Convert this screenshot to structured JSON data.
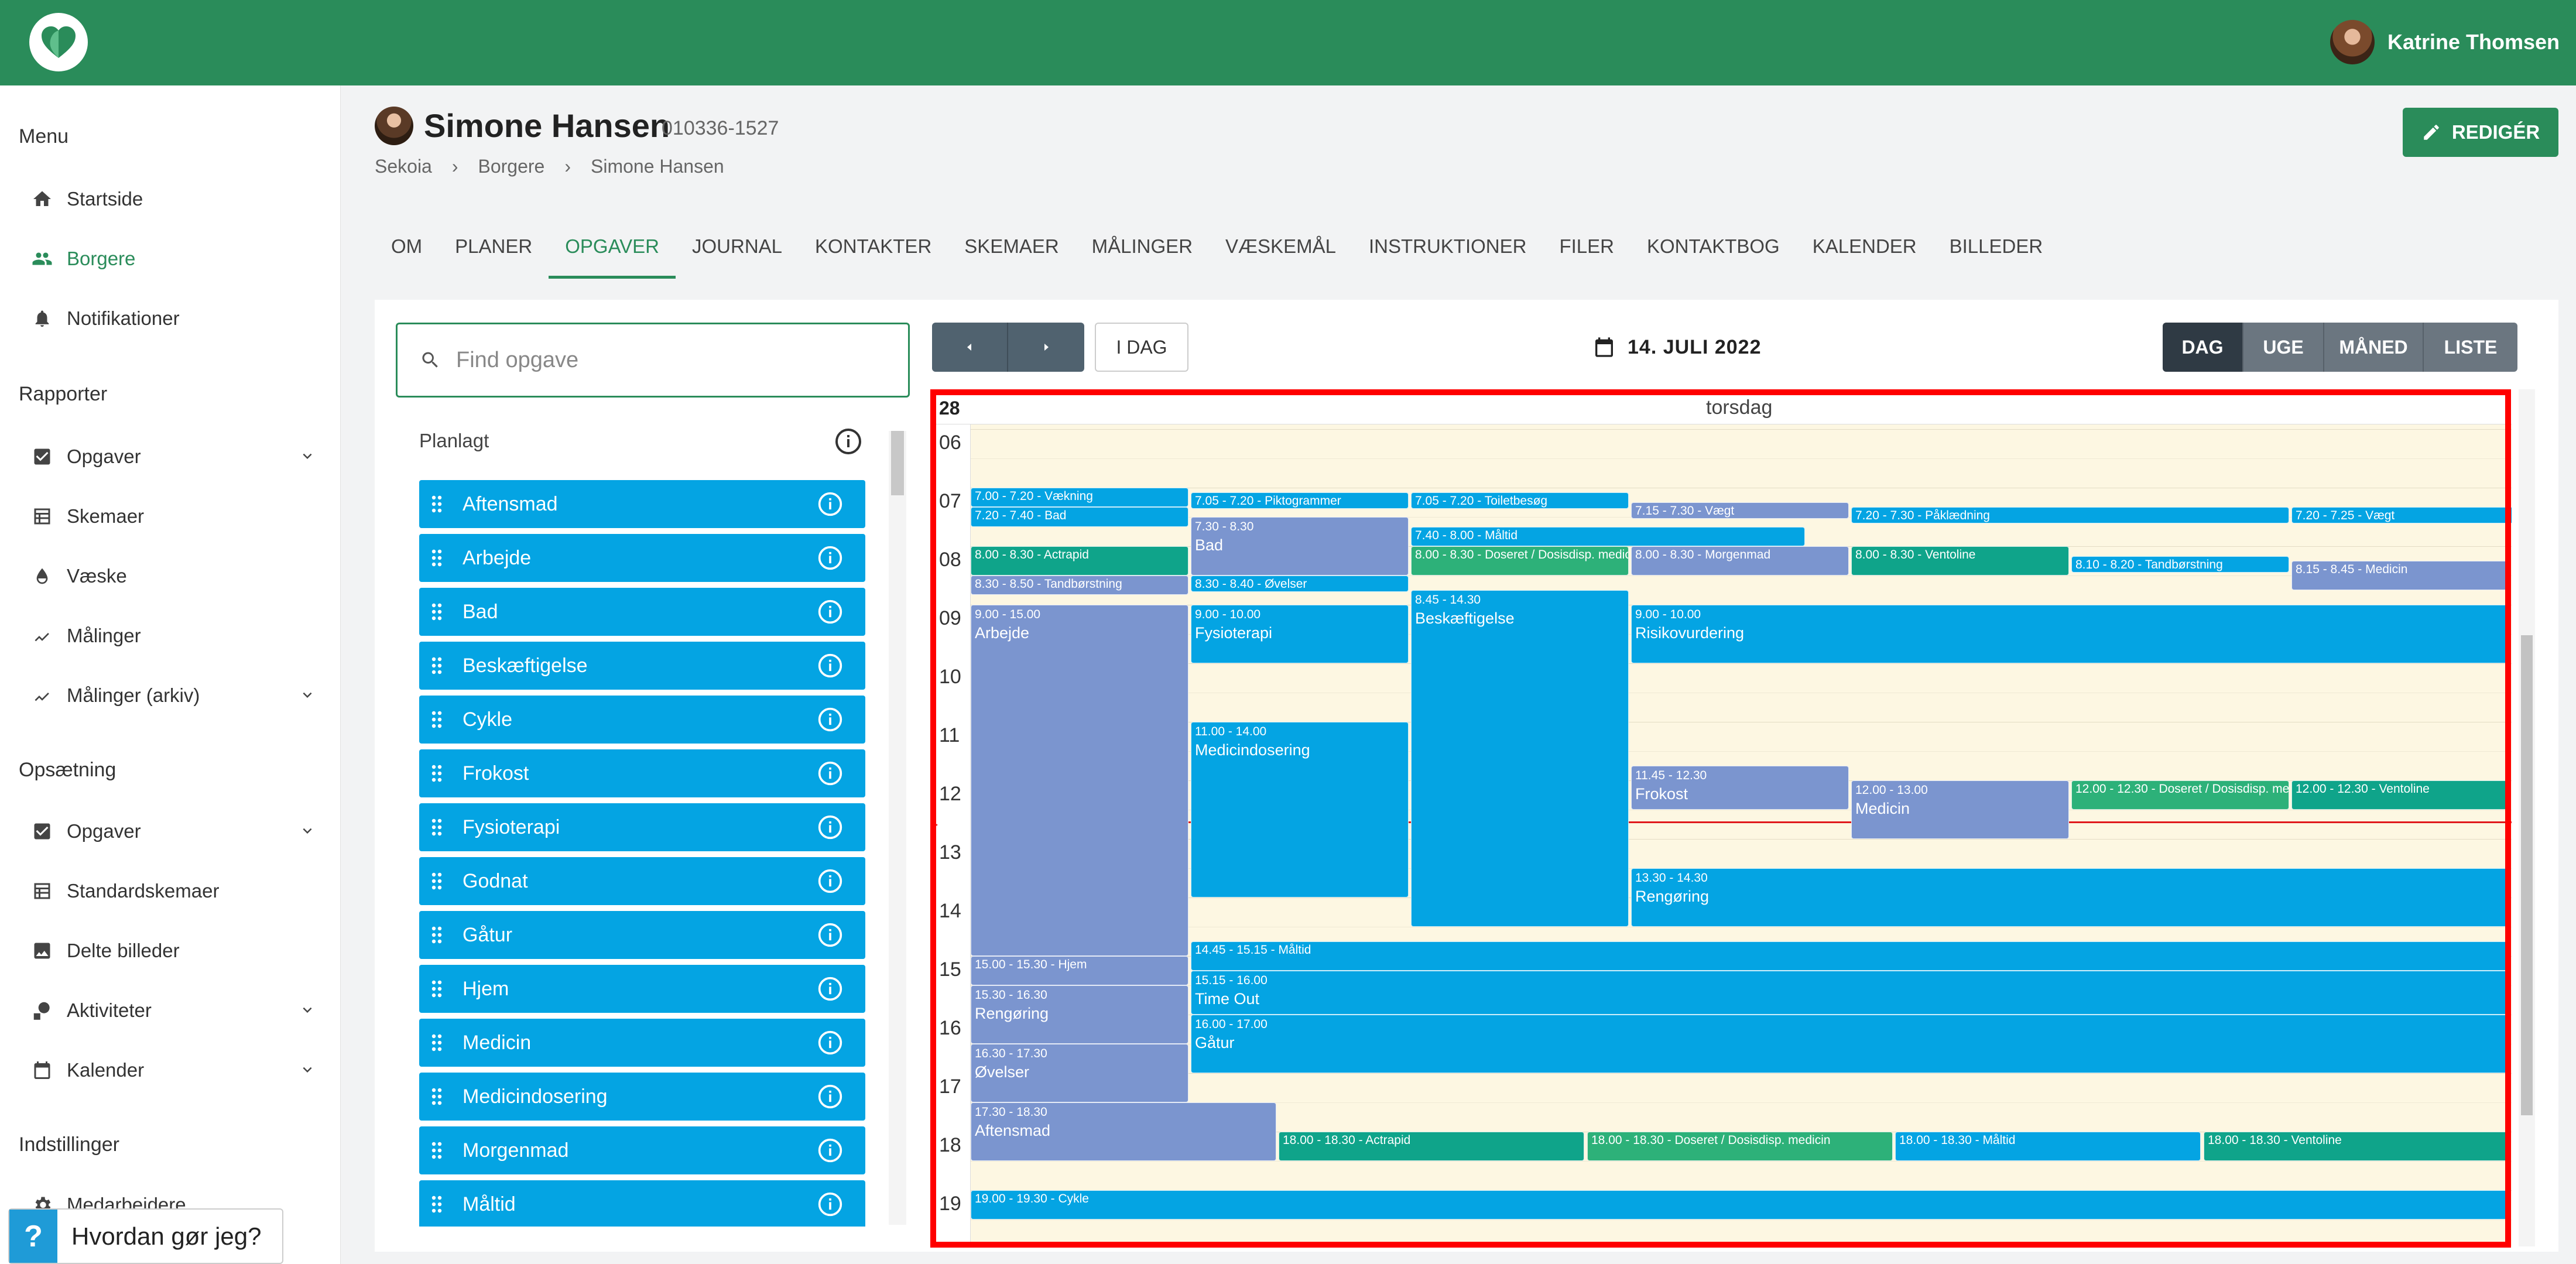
{
  "user": {
    "name": "Katrine Thomsen"
  },
  "sidebar": {
    "sections": [
      {
        "title": "Menu",
        "items": [
          {
            "label": "Startside",
            "icon": "home-icon"
          },
          {
            "label": "Borgere",
            "icon": "people-icon",
            "active": true
          },
          {
            "label": "Notifikationer",
            "icon": "bell-icon"
          }
        ]
      },
      {
        "title": "Rapporter",
        "items": [
          {
            "label": "Opgaver",
            "icon": "checkbox-icon",
            "expandable": true
          },
          {
            "label": "Skemaer",
            "icon": "table-icon"
          },
          {
            "label": "Væske",
            "icon": "drop-icon"
          },
          {
            "label": "Målinger",
            "icon": "trend-icon"
          },
          {
            "label": "Målinger (arkiv)",
            "icon": "trend-icon",
            "expandable": true
          }
        ]
      },
      {
        "title": "Opsætning",
        "items": [
          {
            "label": "Opgaver",
            "icon": "checkbox-icon",
            "expandable": true
          },
          {
            "label": "Standardskemaer",
            "icon": "table-icon"
          },
          {
            "label": "Delte billeder",
            "icon": "image-icon"
          },
          {
            "label": "Aktiviteter",
            "icon": "activity-icon",
            "expandable": true
          },
          {
            "label": "Kalender",
            "icon": "calendar-icon",
            "expandable": true
          }
        ]
      },
      {
        "title": "Indstillinger",
        "items": [
          {
            "label": "Medarbejdere",
            "icon": "gear-icon"
          }
        ]
      }
    ],
    "help": {
      "q": "?",
      "label": "Hvordan gør jeg?"
    }
  },
  "patient": {
    "name": "Simone Hansen",
    "id": "010336-1527"
  },
  "breadcrumb": [
    "Sekoia",
    "Borgere",
    "Simone Hansen"
  ],
  "edit_label": "REDIGÉR",
  "tabs": [
    "OM",
    "PLANER",
    "OPGAVER",
    "JOURNAL",
    "KONTAKTER",
    "SKEMAER",
    "MÅLINGER",
    "VÆSKEMÅL",
    "INSTRUKTIONER",
    "FILER",
    "KONTAKTBOG",
    "KALENDER",
    "BILLEDER"
  ],
  "active_tab": "OPGAVER",
  "search": {
    "placeholder": "Find opgave"
  },
  "planned": {
    "title": "Planlagt",
    "tasks": [
      "Aftensmad",
      "Arbejde",
      "Bad",
      "Beskæftigelse",
      "Cykle",
      "Frokost",
      "Fysioterapi",
      "Godnat",
      "Gåtur",
      "Hjem",
      "Medicin",
      "Medicindosering",
      "Morgenmad",
      "Måltid"
    ]
  },
  "toolbar": {
    "today": "I DAG",
    "date": "14. JULI 2022",
    "views": [
      "DAG",
      "UGE",
      "MÅNED",
      "LISTE"
    ],
    "active_view": "DAG"
  },
  "calendar": {
    "week": "28",
    "day": "torsdag",
    "hours": [
      "06",
      "07",
      "08",
      "09",
      "10",
      "11",
      "12",
      "13",
      "14",
      "15",
      "16",
      "17",
      "18",
      "19"
    ],
    "colors": {
      "blue": "#04a4e3",
      "lavender": "#7b95cf",
      "teal": "#0fa48a",
      "green": "#2db179"
    },
    "events": [
      {
        "time": "7.00 - 7.20",
        "label": "Vækning",
        "color": "blue"
      },
      {
        "time": "7.05 - 7.20",
        "label": "Piktogrammer",
        "color": "blue"
      },
      {
        "time": "7.05 - 7.20",
        "label": "Toiletbesøg",
        "color": "blue"
      },
      {
        "time": "7.15 - 7.30",
        "label": "Vægt",
        "color": "lavender"
      },
      {
        "time": "7.20 - 7.30",
        "label": "Påklædning",
        "color": "blue"
      },
      {
        "time": "7.20 - 7.25",
        "label": "Vægt",
        "color": "blue"
      },
      {
        "time": "7.20 - 7.40",
        "label": "Bad",
        "color": "blue"
      },
      {
        "time": "7.30 - 8.30",
        "label": "Bad",
        "color": "lavender"
      },
      {
        "time": "7.40 - 8.00",
        "label": "Måltid",
        "color": "blue"
      },
      {
        "time": "8.00 - 8.30",
        "label": "Actrapid",
        "color": "teal"
      },
      {
        "time": "8.00 - 8.30",
        "label": "Doseret / Dosisdisp. medicin",
        "color": "green"
      },
      {
        "time": "8.00 - 8.30",
        "label": "Morgenmad",
        "color": "lavender"
      },
      {
        "time": "8.00 - 8.30",
        "label": "Ventoline",
        "color": "teal"
      },
      {
        "time": "8.10 - 8.20",
        "label": "Tandbørstning",
        "color": "blue"
      },
      {
        "time": "8.15 - 8.45",
        "label": "Medicin",
        "color": "lavender"
      },
      {
        "time": "8.30 - 8.50",
        "label": "Tandbørstning",
        "color": "lavender"
      },
      {
        "time": "8.30 - 8.40",
        "label": "Øvelser",
        "color": "blue"
      },
      {
        "time": "8.45 - 14.30",
        "label": "Beskæftigelse",
        "color": "blue"
      },
      {
        "time": "9.00 - 15.00",
        "label": "Arbejde",
        "color": "lavender"
      },
      {
        "time": "9.00 - 10.00",
        "label": "Fysioterapi",
        "color": "blue"
      },
      {
        "time": "9.00 - 10.00",
        "label": "Risikovurdering",
        "color": "blue"
      },
      {
        "time": "11.00 - 14.00",
        "label": "Medicindosering",
        "color": "blue"
      },
      {
        "time": "11.45 - 12.30",
        "label": "Frokost",
        "color": "lavender"
      },
      {
        "time": "12.00 - 13.00",
        "label": "Medicin",
        "color": "lavender"
      },
      {
        "time": "12.00 - 12.30",
        "label": "Doseret / Dosisdisp. medicin",
        "color": "green"
      },
      {
        "time": "12.00 - 12.30",
        "label": "Ventoline",
        "color": "teal"
      },
      {
        "time": "13.30 - 14.30",
        "label": "Rengøring",
        "color": "blue"
      },
      {
        "time": "14.45 - 15.15",
        "label": "Måltid",
        "color": "blue"
      },
      {
        "time": "15.00 - 15.30",
        "label": "Hjem",
        "color": "lavender"
      },
      {
        "time": "15.15 - 16.00",
        "label": "Time Out",
        "color": "blue"
      },
      {
        "time": "15.30 - 16.30",
        "label": "Rengøring",
        "color": "lavender"
      },
      {
        "time": "16.00 - 17.00",
        "label": "Gåtur",
        "color": "blue"
      },
      {
        "time": "16.30 - 17.30",
        "label": "Øvelser",
        "color": "lavender"
      },
      {
        "time": "17.30 - 18.30",
        "label": "Aftensmad",
        "color": "lavender"
      },
      {
        "time": "18.00 - 18.30",
        "label": "Actrapid",
        "color": "teal"
      },
      {
        "time": "18.00 - 18.30",
        "label": "Doseret / Dosisdisp. medicin",
        "color": "green"
      },
      {
        "time": "18.00 - 18.30",
        "label": "Måltid",
        "color": "blue"
      },
      {
        "time": "18.00 - 18.30",
        "label": "Ventoline",
        "color": "teal"
      },
      {
        "time": "19.00 - 19.30",
        "label": "Cykle",
        "color": "blue"
      }
    ]
  }
}
